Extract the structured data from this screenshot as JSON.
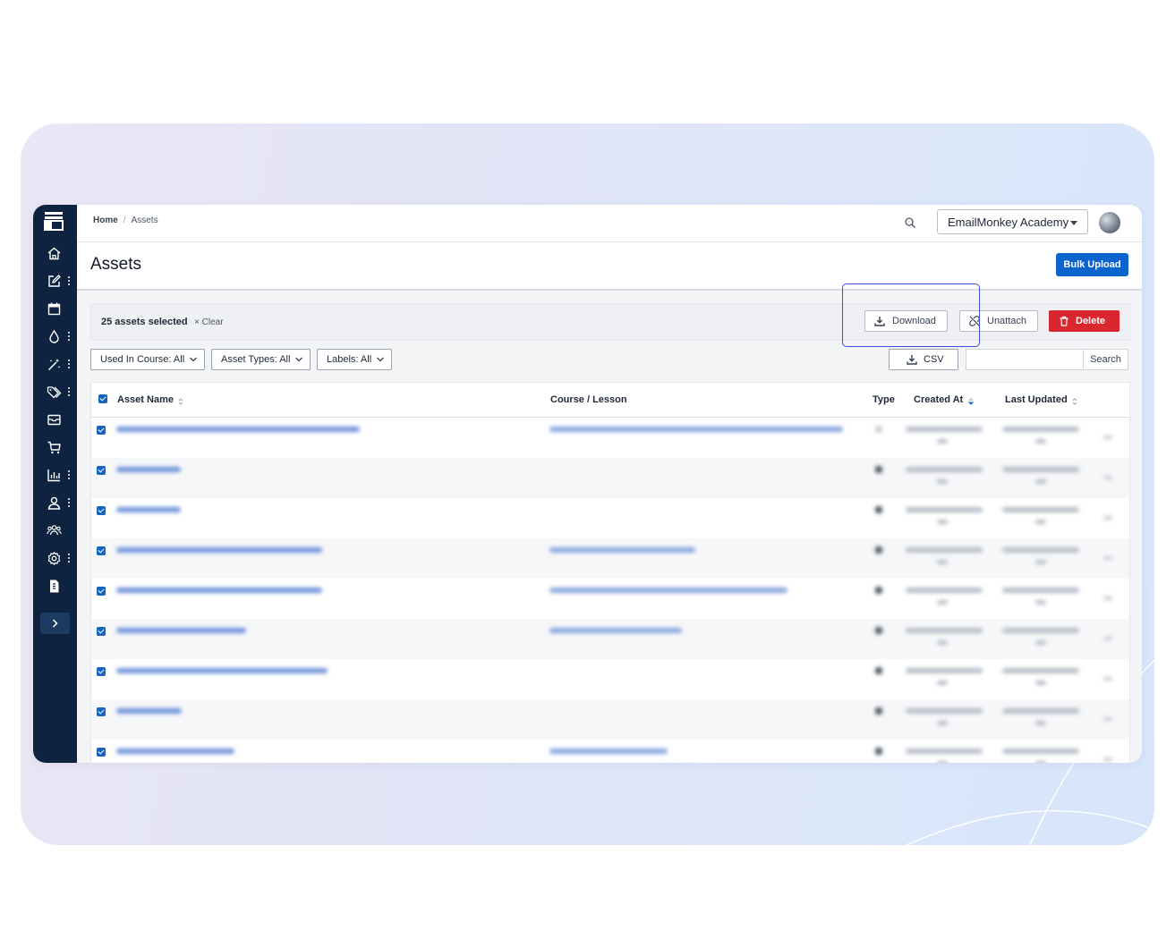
{
  "breadcrumb": {
    "home": "Home",
    "separator": "/",
    "current": "Assets"
  },
  "school_selector": {
    "value": "EmailMonkey Academy"
  },
  "page": {
    "title": "Assets",
    "bulk_upload_label": "Bulk Upload"
  },
  "selection": {
    "count_label": "25 assets selected",
    "clear_label": "Clear",
    "clear_icon": "×",
    "download_label": "Download",
    "unattach_label": "Unattach",
    "delete_label": "Delete"
  },
  "filters": {
    "used_in_course": "Used In Course: All",
    "asset_types": "Asset Types: All",
    "labels": "Labels: All",
    "csv_label": "CSV",
    "search_placeholder": "",
    "search_label": "Search"
  },
  "table": {
    "columns": [
      "Asset Name",
      "Course / Lesson",
      "Type",
      "Created At",
      "Last Updated"
    ]
  },
  "sidebar": {
    "icons": [
      "home-icon",
      "edit-icon",
      "calendar-icon",
      "drop-icon",
      "magic-wand-icon",
      "tag-icon",
      "mail-icon",
      "cart-icon",
      "chart-icon",
      "user-icon",
      "users-icon",
      "settings-icon",
      "file-icon"
    ]
  },
  "colors": {
    "sidebar": "#0d2340",
    "primary": "#0b63ce",
    "danger": "#d9262f",
    "highlight": "#3a4fd0"
  }
}
